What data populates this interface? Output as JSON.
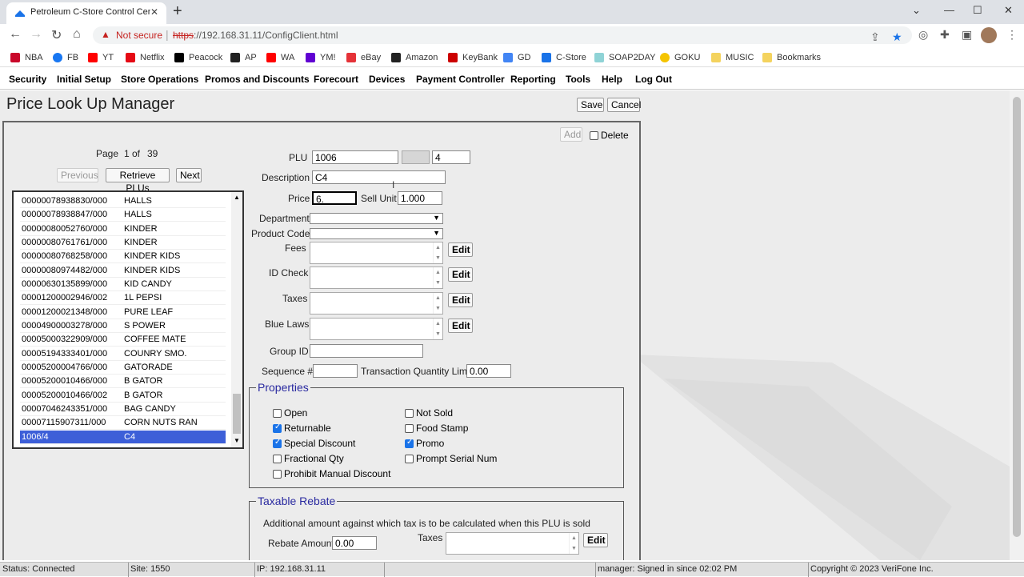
{
  "browser": {
    "tab_title": "Petroleum C-Store Control Cente",
    "tab_close": "✕",
    "new_tab": "+",
    "url_warning": "Not secure",
    "url_scheme": "https",
    "url_rest": "://192.168.31.11/ConfigClient.html",
    "bookmarks": [
      "NBA",
      "FB",
      "YT",
      "Netflix",
      "Peacock",
      "AP",
      "WA",
      "YM!",
      "eBay",
      "Amazon",
      "KeyBank",
      "GD",
      "C-Store",
      "SOAP2DAY",
      "GOKU",
      "MUSIC",
      "Bookmarks"
    ]
  },
  "menu": [
    "Security",
    "Initial Setup",
    "Store Operations",
    "Promos and Discounts",
    "Forecourt",
    "Devices",
    "Payment Controller",
    "Reporting",
    "Tools",
    "Help",
    "Log Out"
  ],
  "page": {
    "title": "Price Look Up Manager",
    "save": "Save",
    "cancel": "Cancel",
    "add": "Add",
    "delete": "Delete"
  },
  "list": {
    "page_label": "Page",
    "page_num": "1",
    "of_label": "of",
    "page_total": "39",
    "previous": "Previous",
    "retrieve": "Retrieve PLUs",
    "next": "Next",
    "rows": [
      {
        "code": "00000078938830/000",
        "name": "HALLS"
      },
      {
        "code": "00000078938847/000",
        "name": "HALLS"
      },
      {
        "code": "00000080052760/000",
        "name": "KINDER"
      },
      {
        "code": "00000080761761/000",
        "name": "KINDER"
      },
      {
        "code": "00000080768258/000",
        "name": "KINDER KIDS"
      },
      {
        "code": "00000080974482/000",
        "name": "KINDER KIDS"
      },
      {
        "code": "00000630135899/000",
        "name": "KID CANDY"
      },
      {
        "code": "00001200002946/002",
        "name": "1L PEPSI"
      },
      {
        "code": "00001200021348/000",
        "name": "PURE LEAF"
      },
      {
        "code": "00004900003278/000",
        "name": "S POWER"
      },
      {
        "code": "00005000322909/000",
        "name": "COFFEE MATE"
      },
      {
        "code": "00005194333401/000",
        "name": "COUNRY SMO."
      },
      {
        "code": "00005200004766/000",
        "name": "GATORADE"
      },
      {
        "code": "00005200010466/000",
        "name": "B GATOR"
      },
      {
        "code": "00005200010466/002",
        "name": "B GATOR"
      },
      {
        "code": "00007046243351/000",
        "name": "BAG CANDY"
      },
      {
        "code": "00007115907311/000",
        "name": "CORN NUTS RAN"
      },
      {
        "code": "1006/4",
        "name": "C4"
      }
    ]
  },
  "form": {
    "plu_label": "PLU",
    "plu_value": "1006",
    "plu_modifier": "4",
    "description_label": "Description",
    "description_value": "C4",
    "price_label": "Price",
    "price_value": "6.",
    "sell_unit_label": "Sell Unit",
    "sell_unit_value": "1.000",
    "department_label": "Department",
    "product_code_label": "Product Code",
    "fees_label": "Fees",
    "id_check_label": "ID Check",
    "taxes_label": "Taxes",
    "blue_laws_label": "Blue Laws",
    "edit": "Edit",
    "group_id_label": "Group ID",
    "sequence_label": "Sequence #",
    "txn_qty_label": "Transaction Quantity Limit",
    "txn_qty_value": "0.00"
  },
  "properties": {
    "legend": "Properties",
    "open": "Open",
    "returnable": "Returnable",
    "special_discount": "Special Discount",
    "fractional_qty": "Fractional Qty",
    "prohibit_manual_discount": "Prohibit Manual Discount",
    "not_sold": "Not Sold",
    "food_stamp": "Food Stamp",
    "promo": "Promo",
    "prompt_serial_num": "Prompt Serial Num"
  },
  "rebate": {
    "legend": "Taxable Rebate",
    "description": "Additional amount against which tax is to be calculated when this PLU is sold",
    "amount_label": "Rebate Amount",
    "amount_value": "0.00",
    "taxes_label": "Taxes"
  },
  "status": {
    "connection": "Status: Connected",
    "site": "Site: 1550",
    "ip": "IP: 192.168.31.11",
    "signed_in": "manager: Signed in since 02:02 PM",
    "copyright": "Copyright © 2023 VeriFone Inc."
  },
  "colors": {
    "selection": "#3d5fd8",
    "legend": "#2a2aa0",
    "warning": "#c5221f",
    "checkbox": "#1a73e8"
  }
}
